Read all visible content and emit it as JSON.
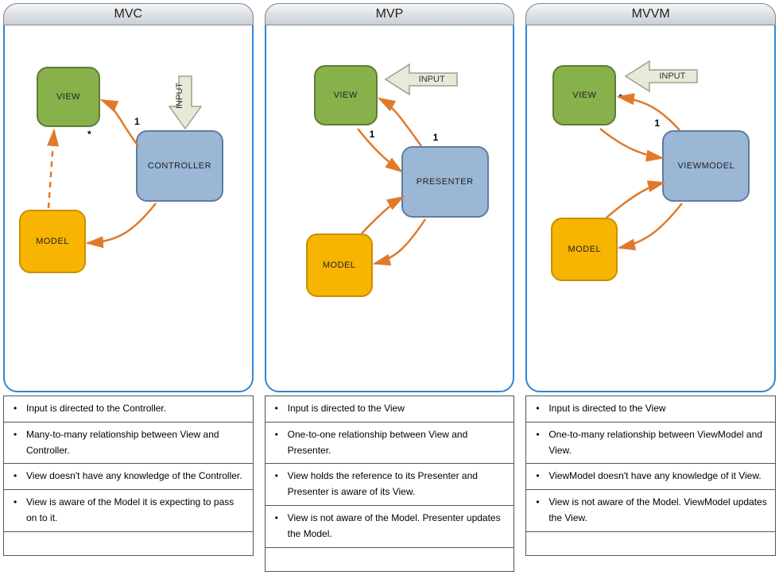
{
  "panels": [
    {
      "title": "MVC",
      "nodes": {
        "view": "VIEW",
        "controller": "CONTROLLER",
        "model": "MODEL"
      },
      "cardinality": {
        "view": "*",
        "controller": "1"
      },
      "input_label": "INPUT",
      "input_target": "controller",
      "notes": [
        "Input is directed to the Controller.",
        "Many-to-many relationship between View and Controller.",
        "View doesn't have any knowledge of the Controller.",
        "View is aware of the Model it is expecting to pass on to it."
      ]
    },
    {
      "title": "MVP",
      "nodes": {
        "view": "VIEW",
        "controller": "PRESENTER",
        "model": "MODEL"
      },
      "cardinality": {
        "view": "1",
        "controller": "1"
      },
      "input_label": "INPUT",
      "input_target": "view",
      "notes": [
        "Input is directed to the View",
        "One-to-one relationship between View and Presenter.",
        "View holds the reference to its Presenter and Presenter is aware of its View.",
        "View is not aware of the Model. Presenter updates the Model."
      ]
    },
    {
      "title": "MVVM",
      "nodes": {
        "view": "VIEW",
        "controller": "VIEWMODEL",
        "model": "MODEL"
      },
      "cardinality": {
        "view": "*",
        "controller": "1"
      },
      "input_label": "INPUT",
      "input_target": "view",
      "notes": [
        "Input is directed to the  View",
        "One-to-many relationship between ViewModel and View.",
        "ViewModel doesn't have any knowledge of it View.",
        "View is not aware of the Model. ViewModel updates the View."
      ]
    }
  ],
  "colors": {
    "arrow": "#e07a2b",
    "input_fill": "#e7ead9",
    "input_stroke": "#9aa28c"
  }
}
